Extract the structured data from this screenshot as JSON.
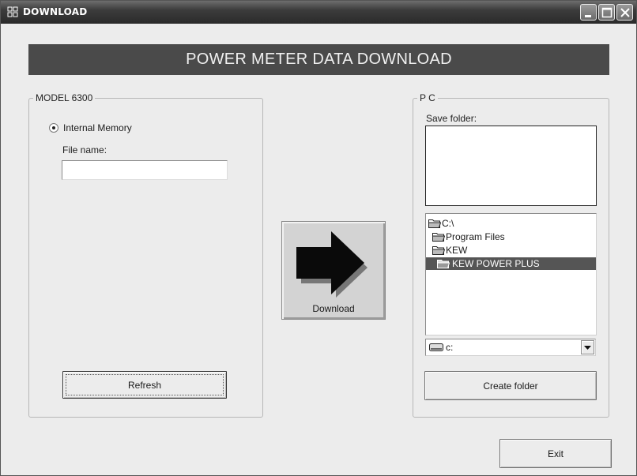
{
  "window": {
    "title": "DOWNLOAD"
  },
  "banner": {
    "title": "POWER METER DATA DOWNLOAD"
  },
  "model_group": {
    "legend": "MODEL 6300",
    "radio_label": "Internal Memory",
    "radio_selected": true,
    "file_name_label": "File name:",
    "file_name_value": "",
    "refresh_label": "Refresh"
  },
  "download": {
    "label": "Download"
  },
  "pc_group": {
    "legend": "P C",
    "save_folder_label": "Save folder:",
    "save_folder_value": "",
    "folders": [
      {
        "name": "C:\\",
        "selected": false
      },
      {
        "name": "Program Files",
        "selected": false
      },
      {
        "name": "KEW",
        "selected": false
      },
      {
        "name": "KEW POWER PLUS",
        "selected": true
      }
    ],
    "drive": "c:",
    "create_folder_label": "Create folder"
  },
  "footer": {
    "exit_label": "Exit"
  },
  "icons": {
    "app": "app-icon",
    "minimize": "minimize-icon",
    "maximize": "maximize-icon",
    "close": "close-icon",
    "arrow": "right-arrow-icon",
    "folder": "folder-icon",
    "drive": "drive-icon",
    "dropdown": "chevron-down-icon"
  },
  "colors": {
    "banner_bg": "#4a4a4a",
    "selection_bg": "#555555"
  }
}
